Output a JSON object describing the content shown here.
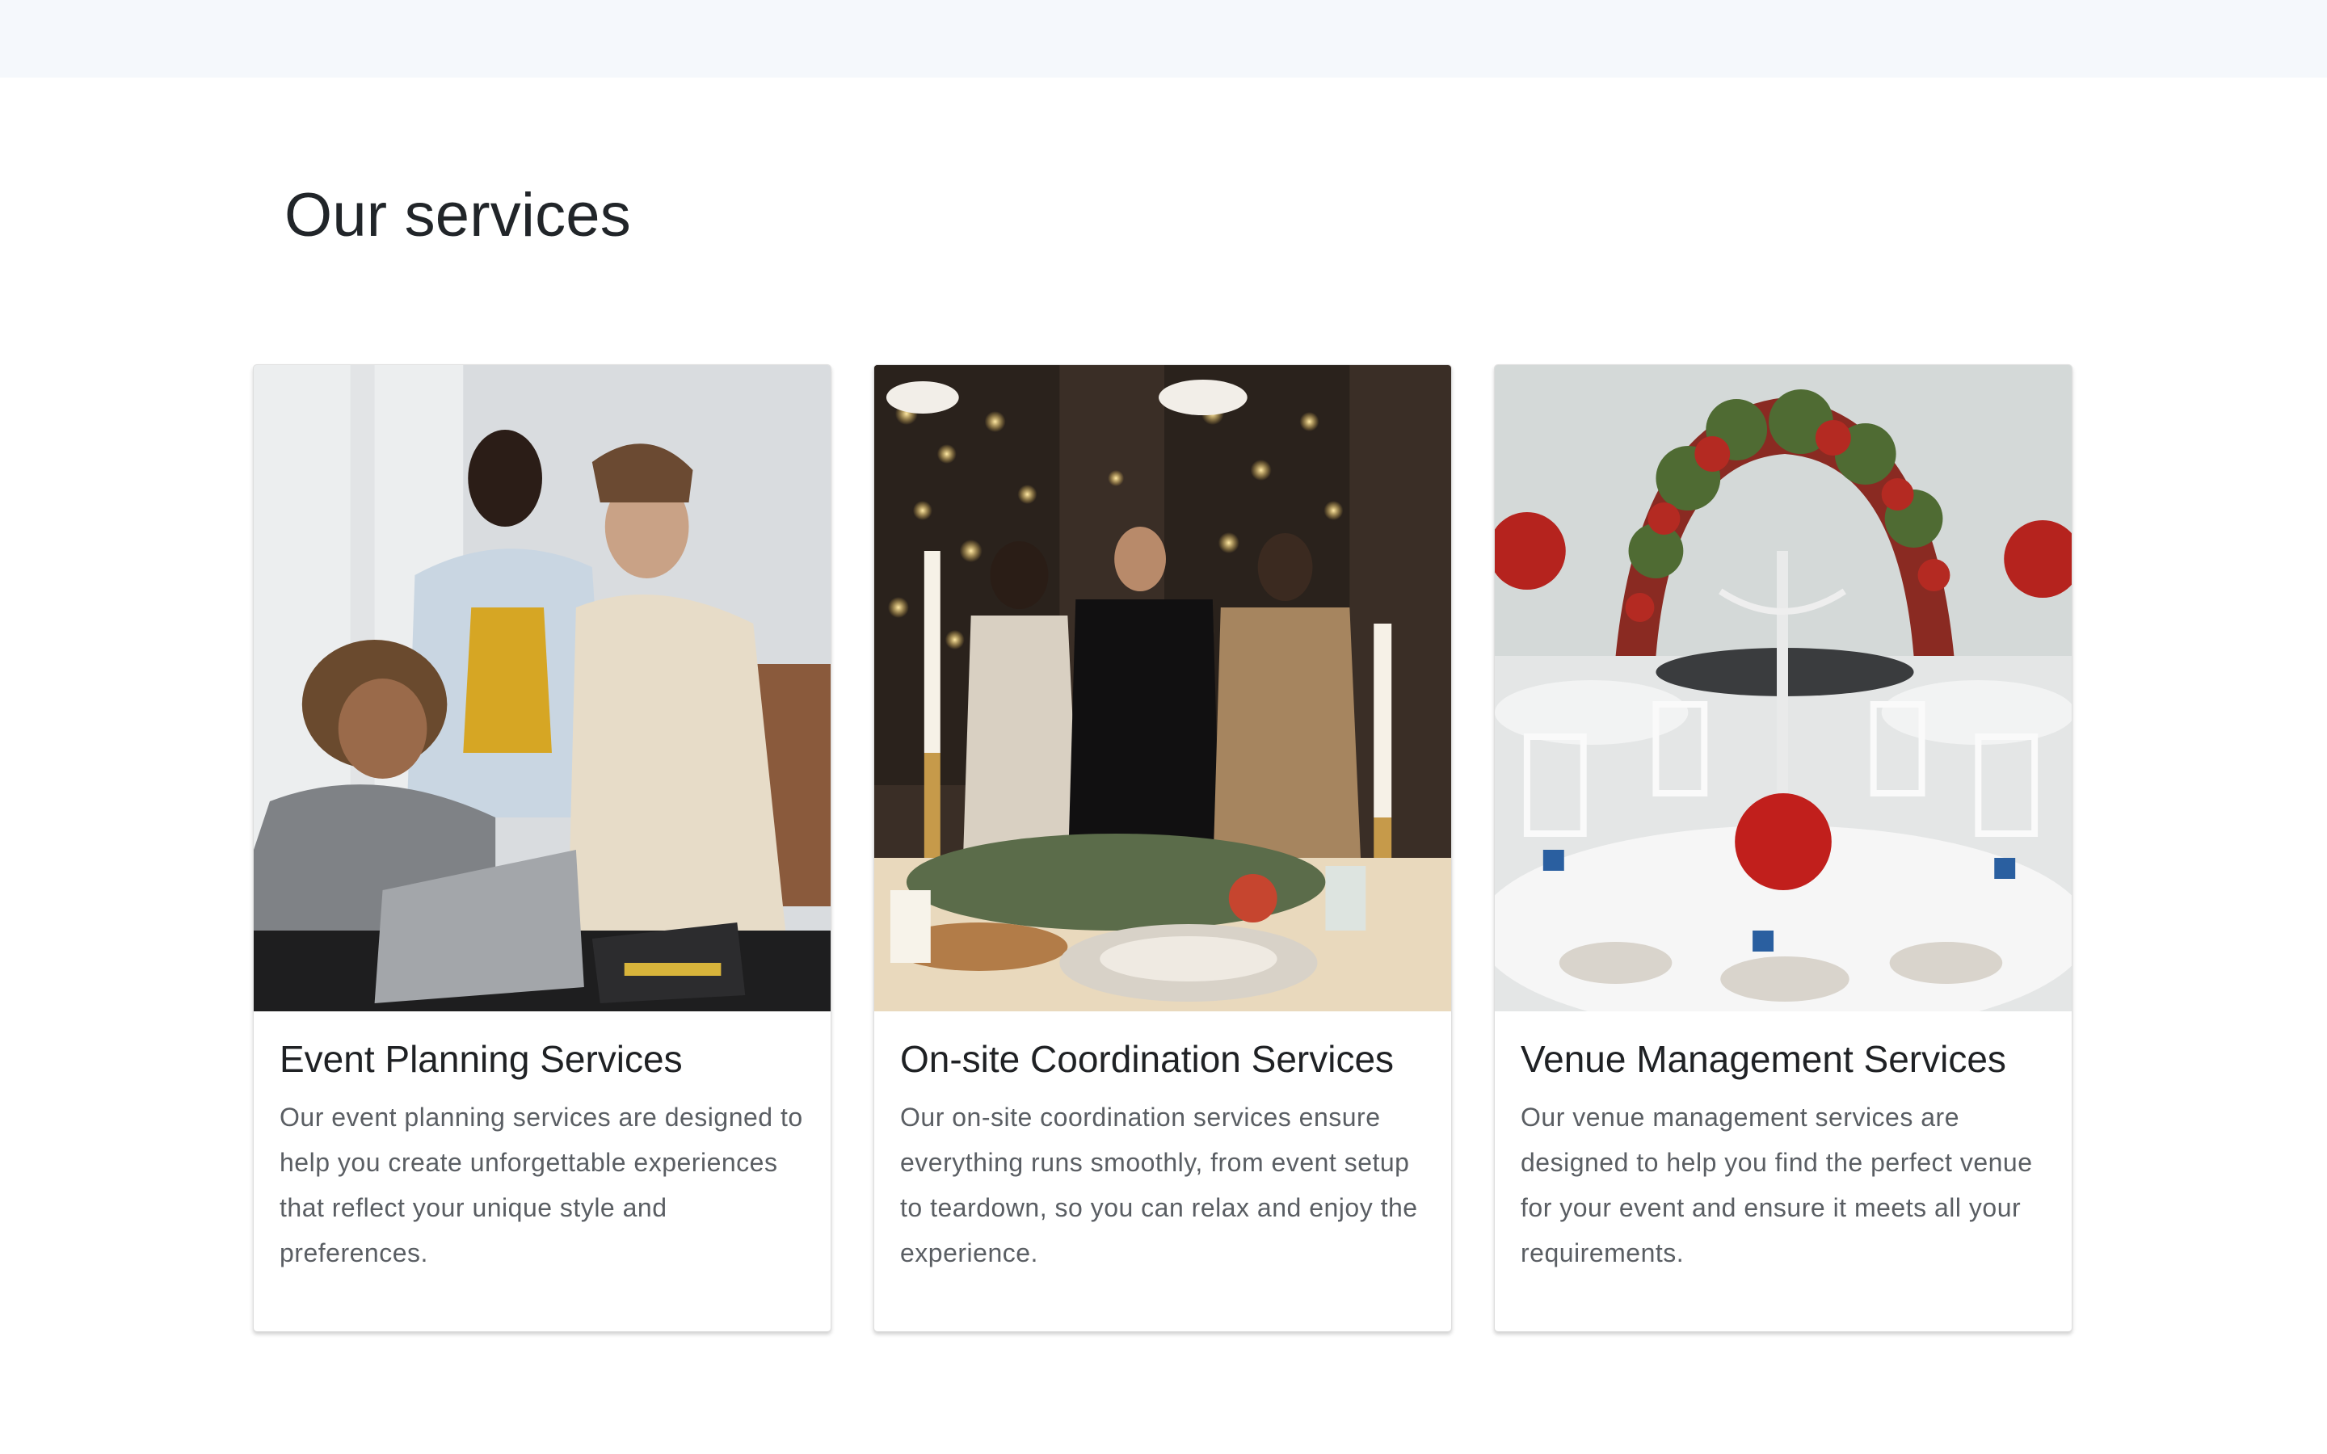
{
  "page": {
    "section_title": "Our services"
  },
  "services": [
    {
      "title": "Event Planning Services",
      "description": "Our event planning services are designed to help you create unforgettable experiences that reflect your unique style and preferences.",
      "image": "team-planning-photo"
    },
    {
      "title": "On-site Coordination Services",
      "description": "Our on-site coordination services ensure everything runs smoothly, from event setup to teardown, so you can relax and enjoy the experience.",
      "image": "candlelit-dinner-photo"
    },
    {
      "title": "Venue Management Services",
      "description": "Our venue management services are designed to help you find the perfect venue for your event and ensure it meets all your requirements.",
      "image": "banquet-hall-photo"
    }
  ],
  "colors": {
    "topbar": "#f5f8fc",
    "title_text": "#212529",
    "body_text": "#5a5e63"
  }
}
